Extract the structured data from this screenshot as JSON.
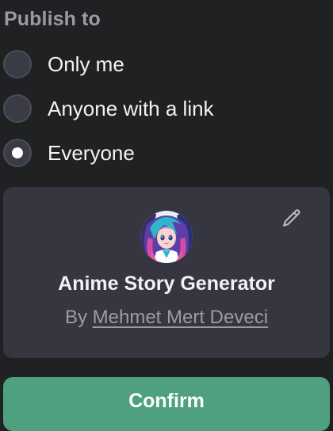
{
  "publish": {
    "title": "Publish to",
    "options": [
      {
        "label": "Only me",
        "selected": false
      },
      {
        "label": "Anyone with a link",
        "selected": false
      },
      {
        "label": "Everyone",
        "selected": true
      }
    ]
  },
  "gpt_card": {
    "name": "Anime Story Generator",
    "by_prefix": "By",
    "author": "Mehmet Mert Deveci",
    "edit_icon": "pencil-icon",
    "avatar_icon": "anime-girl-avatar"
  },
  "actions": {
    "confirm_label": "Confirm"
  },
  "colors": {
    "background": "#202123",
    "card": "#353640",
    "confirm_button": "#4ea07e",
    "radio_fill": "#3a3b45"
  }
}
